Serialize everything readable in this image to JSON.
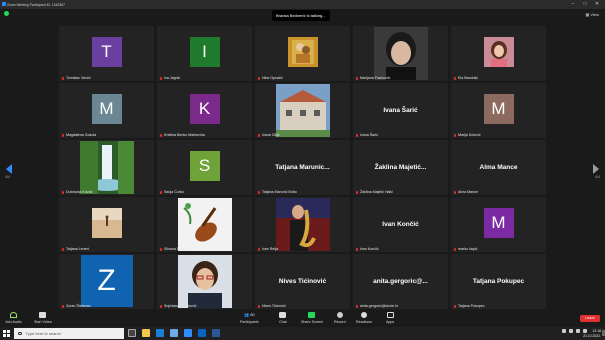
{
  "window": {
    "title": "Zoom Meeting Participant ID: 1242367"
  },
  "top": {
    "speaker_banner": "Branka Bednerić is talking...",
    "view_label": "View"
  },
  "pager": {
    "left": "4/4",
    "right": "4/4"
  },
  "tiles": [
    {
      "type": "avatar",
      "letter": "T",
      "color": "#6b3fa0",
      "name": "Tomislav Verzić"
    },
    {
      "type": "avatar",
      "letter": "I",
      "color": "#1f7a2e",
      "name": "Iva Jagnić"
    },
    {
      "type": "photo",
      "photo": "klimt",
      "name": "Nina Oprašić"
    },
    {
      "type": "photo",
      "photo": "portrait-dark",
      "name": "Marijana Franković"
    },
    {
      "type": "photo",
      "photo": "portrait-woman",
      "name": "Ela Bandulić"
    },
    {
      "type": "avatar",
      "letter": "M",
      "color": "#6b8794",
      "name": "Magdalena Goluža"
    },
    {
      "type": "avatar",
      "letter": "K",
      "color": "#7b2a8c",
      "name": "Kristina Benko Markovina"
    },
    {
      "type": "photo",
      "photo": "building",
      "name": "Ivana Glijić"
    },
    {
      "type": "name",
      "display": "Ivana Šarić",
      "name": "Ivana Šarić"
    },
    {
      "type": "avatar",
      "letter": "M",
      "color": "#8c6a5f",
      "name": "Marija Dolović"
    },
    {
      "type": "photo",
      "photo": "waterfall",
      "name": "Dubravka Kovač"
    },
    {
      "type": "avatar",
      "letter": "S",
      "color": "#6fa33a",
      "name": "Sanja Ćurko"
    },
    {
      "type": "name",
      "display": "Tatjana Marunic...",
      "name": "Tatjana Marunić Brdio"
    },
    {
      "type": "name",
      "display": "Žaklina Majetić...",
      "name": "Žaklina Majetić Halić"
    },
    {
      "type": "name",
      "display": "Alma Mance",
      "name": "Alma Mance"
    },
    {
      "type": "photo",
      "photo": "desert-small",
      "name": "Tatjana Lenert"
    },
    {
      "type": "photo",
      "photo": "violin",
      "name": "Silvana Dujić"
    },
    {
      "type": "photo",
      "photo": "saxophone",
      "name": "Ivan Relja"
    },
    {
      "type": "name",
      "display": "Ivan Končić",
      "name": "Ivan Končić"
    },
    {
      "type": "avatar",
      "letter": "M",
      "color": "#7b2aa3",
      "name": "marko čapić"
    },
    {
      "type": "avatar",
      "letter": "Z",
      "color": "#0f63b0",
      "name": "Zoran Štefanac",
      "big": true
    },
    {
      "type": "photo",
      "photo": "woman-glasses",
      "name": "Snježana Stojaković"
    },
    {
      "type": "name",
      "display": "Nives Tićinović",
      "name": "Nives Tićinović"
    },
    {
      "type": "name",
      "display": "anita.gergoric@...",
      "name": "anita.gergoric@skole.hr"
    },
    {
      "type": "name",
      "display": "Tatjana Pokupec",
      "name": "Tatjana Pokupec"
    }
  ],
  "toolbar": {
    "join_audio": "Join Audio",
    "start_video": "Start Video",
    "participants": "Participants",
    "participants_count": "80",
    "chat": "Chat",
    "share_screen": "Share Screen",
    "record": "Record",
    "reactions": "Reactions",
    "apps": "Apps",
    "leave": "Leave"
  },
  "taskbar": {
    "search_placeholder": "Type here to search",
    "time": "12:16",
    "date": "21.10.2022."
  }
}
